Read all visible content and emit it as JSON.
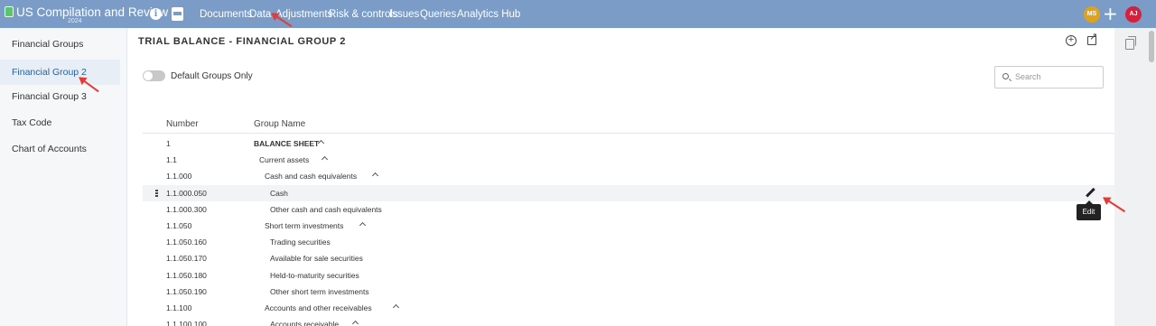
{
  "app": {
    "title": "US Compilation and Review",
    "year": "2024"
  },
  "topnav": {
    "info_glyph": "i",
    "items": [
      "Documents",
      "Data",
      "Adjustments",
      "Risk & controls",
      "Issues",
      "Queries",
      "Analytics Hub"
    ],
    "avatars": [
      {
        "initials": "MS",
        "color": "#e0a21b"
      },
      {
        "initials": "AJ",
        "color": "#d8203c"
      }
    ]
  },
  "sidebar": {
    "items": [
      "Financial Groups",
      "Financial Group 2",
      "Financial Group 3",
      "Tax Code",
      "Chart of Accounts"
    ],
    "active_index": 1
  },
  "main": {
    "title": "TRIAL BALANCE - FINANCIAL GROUP 2",
    "toggle_label": "Default Groups Only",
    "toggle_on": false,
    "search_placeholder": "Search",
    "columns": {
      "number": "Number",
      "group_name": "Group Name"
    },
    "rows": [
      {
        "number": "1",
        "name": "BALANCE SHEET",
        "level": 0,
        "expanded": true,
        "bold": true
      },
      {
        "number": "1.1",
        "name": "Current assets",
        "level": 1,
        "expanded": true
      },
      {
        "number": "1.1.000",
        "name": "Cash and cash equivalents",
        "level": 2,
        "expanded": true
      },
      {
        "number": "1.1.000.050",
        "name": "Cash",
        "level": 3,
        "hover": true
      },
      {
        "number": "1.1.000.300",
        "name": "Other cash and cash equivalents",
        "level": 3
      },
      {
        "number": "1.1.050",
        "name": "Short term investments",
        "level": 2,
        "expanded": true
      },
      {
        "number": "1.1.050.160",
        "name": "Trading securities",
        "level": 3
      },
      {
        "number": "1.1.050.170",
        "name": "Available for sale securities",
        "level": 3
      },
      {
        "number": "1.1.050.180",
        "name": "Held-to-maturity securities",
        "level": 3
      },
      {
        "number": "1.1.050.190",
        "name": "Other short term investments",
        "level": 3
      },
      {
        "number": "1.1.100",
        "name": "Accounts and other receivables",
        "level": 2,
        "expanded": true
      },
      {
        "number": "1.1.100.100",
        "name": "Accounts receivable",
        "level": 3,
        "expanded": true
      }
    ],
    "edit_tooltip": "Edit"
  },
  "icons": {
    "info": "info-icon",
    "documents": "document-icon",
    "add_top": "plus-icon",
    "add_group": "circle-plus-icon",
    "open_external": "external-link-icon",
    "search": "search-icon",
    "edit": "pencil-icon",
    "drag": "drag-handle-icon",
    "copy": "copy-icon",
    "annotation": "red-arrow-icon"
  },
  "colors": {
    "topbar": "#7a9cc6",
    "active_sidebar_text": "#2a5f9e",
    "annotation_arrow": "#e53935"
  }
}
